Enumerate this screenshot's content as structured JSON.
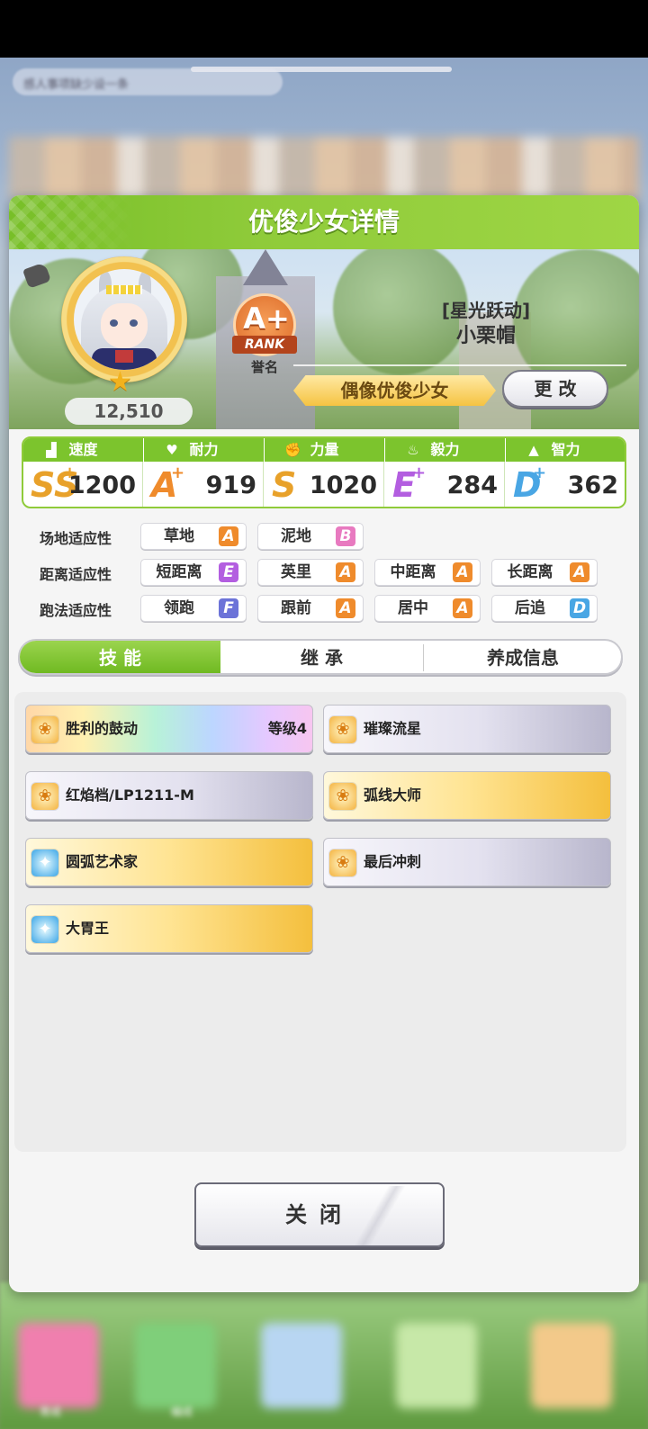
{
  "background": {
    "chat_preview": "感人事项缺少设一条",
    "bottom_nav": [
      "育成",
      "编成",
      "",
      "",
      "",
      ""
    ]
  },
  "panel": {
    "title": "优俊少女详情",
    "fans": "12,510",
    "rank": {
      "grade": "A+",
      "badge_text": "RANK",
      "label": "誉名"
    },
    "title_bracket": "[星光跃动]",
    "name": "小栗帽",
    "epithet": "偶像优俊少女",
    "change_button": "更 改"
  },
  "stats": [
    {
      "label": "速度",
      "icon": "shoe-icon",
      "grade": "SS",
      "plus": "+",
      "value": "1200",
      "color": "#e8a12a"
    },
    {
      "label": "耐力",
      "icon": "heart-icon",
      "grade": "A",
      "plus": "+",
      "value": "919",
      "color": "#ef8b2c"
    },
    {
      "label": "力量",
      "icon": "arm-icon",
      "grade": "S",
      "plus": "",
      "value": "1020",
      "color": "#e8a12a"
    },
    {
      "label": "毅力",
      "icon": "flame-icon",
      "grade": "E",
      "plus": "+",
      "value": "284",
      "color": "#b35ee0"
    },
    {
      "label": "智力",
      "icon": "graduation-cap-icon",
      "grade": "D",
      "plus": "+",
      "value": "362",
      "color": "#49a6e4"
    }
  ],
  "aptitudes": {
    "rows": [
      {
        "label": "场地适应性",
        "items": [
          {
            "name": "草地",
            "grade": "A"
          },
          {
            "name": "泥地",
            "grade": "B"
          }
        ]
      },
      {
        "label": "距离适应性",
        "items": [
          {
            "name": "短距离",
            "grade": "E"
          },
          {
            "name": "英里",
            "grade": "A"
          },
          {
            "name": "中距离",
            "grade": "A"
          },
          {
            "name": "长距离",
            "grade": "A"
          }
        ]
      },
      {
        "label": "跑法适应性",
        "items": [
          {
            "name": "领跑",
            "grade": "F"
          },
          {
            "name": "跟前",
            "grade": "A"
          },
          {
            "name": "居中",
            "grade": "A"
          },
          {
            "name": "后追",
            "grade": "D"
          }
        ]
      }
    ],
    "grade_colors": {
      "A": "#ef8b2c",
      "B": "#e87ac0",
      "D": "#49a6e4",
      "E": "#b35ee0",
      "F": "#6c73d8"
    }
  },
  "tabs": [
    "技 能",
    "继 承",
    "养成信息"
  ],
  "skills": [
    {
      "name": "胜利的鼓动",
      "level": "等级4",
      "style": "rainbow",
      "icon": "gold"
    },
    {
      "name": "璀璨流星",
      "level": "",
      "style": "silver",
      "icon": "gold"
    },
    {
      "name": "红焰档/LP1211-M",
      "level": "",
      "style": "silver",
      "icon": "gold"
    },
    {
      "name": "弧线大师",
      "level": "",
      "style": "gold",
      "icon": "gold"
    },
    {
      "name": "圆弧艺术家",
      "level": "",
      "style": "gold",
      "icon": "blue"
    },
    {
      "name": "最后冲刺",
      "level": "",
      "style": "silver",
      "icon": "gold"
    },
    {
      "name": "大胃王",
      "level": "",
      "style": "gold",
      "icon": "blue"
    }
  ],
  "close_button": "关闭"
}
